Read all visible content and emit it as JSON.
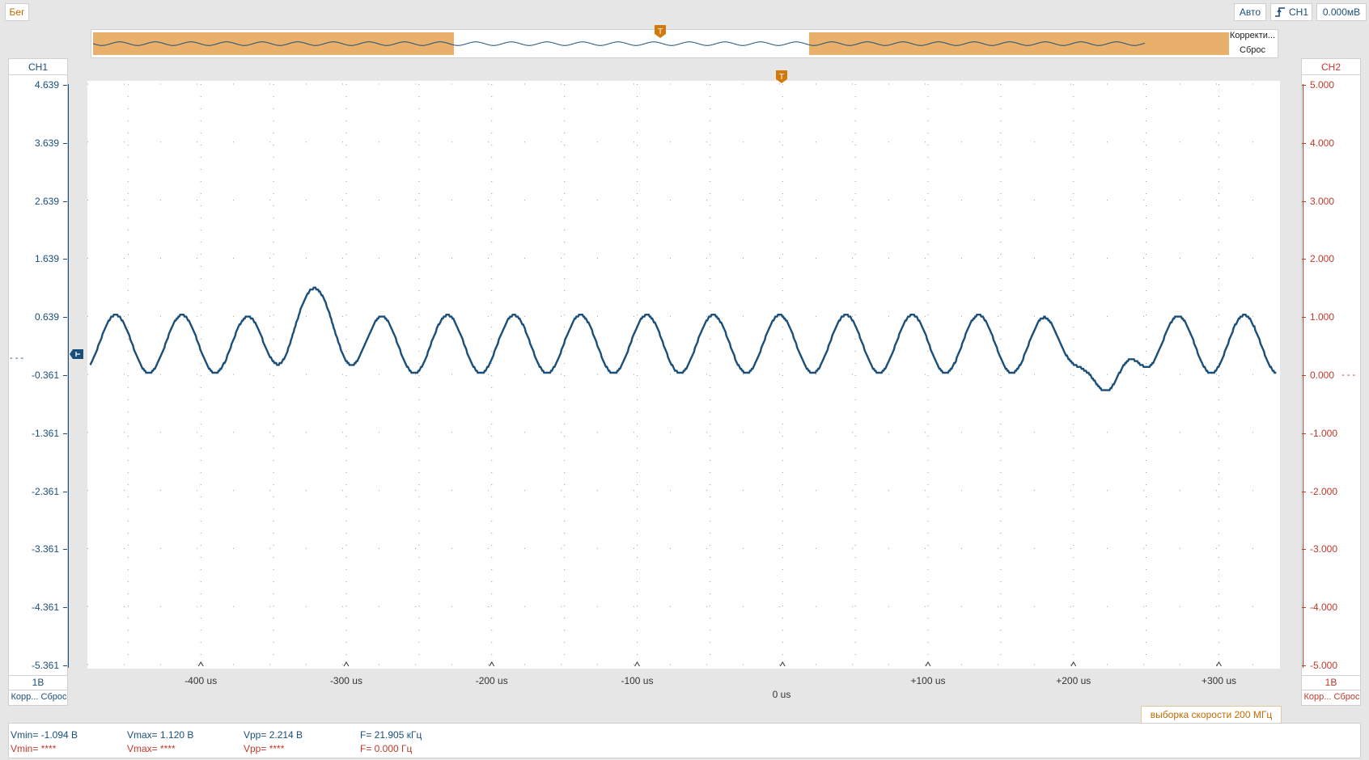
{
  "toolbar": {
    "run_label": "Бег",
    "mode_label": "Авто",
    "trigger_channel_label": "CH1",
    "trigger_level_label": "0.000мВ"
  },
  "overview": {
    "correct_label": "Корректи...",
    "reset_label": "Сброс",
    "trigger_marker": "T"
  },
  "ch1": {
    "title": "CH1",
    "ticks": [
      "4.639",
      "3.639",
      "2.639",
      "1.639",
      "0.639",
      "-0.361",
      "-1.361",
      "-2.361",
      "-3.361",
      "-4.361",
      "-5.361"
    ],
    "scale_label": "1В",
    "footer_label": "Корр... Сброс",
    "color": "#1a4f7a"
  },
  "ch2": {
    "title": "CH2",
    "ticks": [
      "5.000",
      "4.000",
      "3.000",
      "2.000",
      "1.000",
      "0.000",
      "-1.000",
      "-2.000",
      "-3.000",
      "-4.000",
      "-5.000"
    ],
    "scale_label": "1В",
    "footer_label": "Корр... Сброс",
    "color": "#c0392b"
  },
  "x_axis": {
    "labels": [
      "-400 us",
      "-300 us",
      "-200 us",
      "-100 us",
      "+100 us",
      "+200 us",
      "+300 us"
    ],
    "center_label": "0 us"
  },
  "trigger_marker": "T",
  "sample_rate_label": "выборка скорости 200 МГц",
  "measurements": {
    "ch1": {
      "vmin": "Vmin= -1.094 В",
      "vmax": "Vmax= 1.120 В",
      "vpp": "Vpp= 2.214 В",
      "freq": "F= 21.905 кГц"
    },
    "ch2": {
      "vmin": "Vmin= ****",
      "vmax": "Vmax= ****",
      "vpp": "Vpp= ****",
      "freq": "F= 0.000 Гц"
    }
  },
  "chart_data": {
    "type": "line",
    "x_unit": "us",
    "xlim": [
      -478,
      342
    ],
    "ylim_ch1": [
      -5.361,
      4.639
    ],
    "ylim_ch2": [
      -5.0,
      5.0
    ],
    "grid": true,
    "series": [
      {
        "name": "CH1",
        "frequency_khz": 21.905,
        "vmin": -1.094,
        "vmax": 1.12,
        "offset_v": 0.0,
        "amplitude_v": 0.5,
        "anomalies": [
          {
            "t_us": -322,
            "peak_v": 1.12
          },
          {
            "t_us": 222,
            "peak_v": -0.65
          }
        ]
      }
    ]
  }
}
